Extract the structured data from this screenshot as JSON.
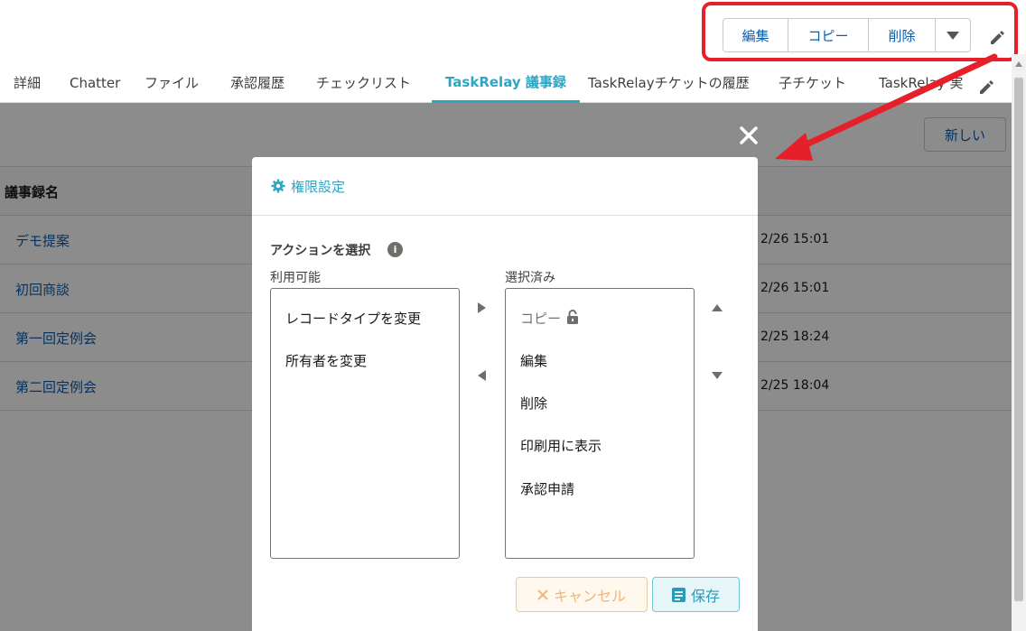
{
  "record_actions": {
    "edit_label": "編集",
    "copy_label": "コピー",
    "delete_label": "削除"
  },
  "tabs": [
    {
      "label": "詳細"
    },
    {
      "label": "Chatter"
    },
    {
      "label": "ファイル"
    },
    {
      "label": "承認履歴"
    },
    {
      "label": "チェックリスト"
    },
    {
      "label": "TaskRelay 議事録"
    },
    {
      "label": "TaskRelayチケットの履歴"
    },
    {
      "label": "子チケット"
    },
    {
      "label": "TaskRelay 実"
    }
  ],
  "list": {
    "new_label": "新しい",
    "column_header": "議事録名",
    "rows": [
      {
        "name": "デモ提案",
        "date": "2/26 15:01"
      },
      {
        "name": "初回商談",
        "date": "2/26 15:01"
      },
      {
        "name": "第一回定例会",
        "date": "2/25 18:24"
      },
      {
        "name": "第二回定例会",
        "date": "2/25 18:04"
      }
    ]
  },
  "modal": {
    "title": "権限設定",
    "section_label": "アクションを選択",
    "info_icon_text": "i",
    "available_label": "利用可能",
    "selected_label": "選択済み",
    "available_items": [
      "レコードタイプを変更",
      "所有者を変更"
    ],
    "selected_items": [
      "コピー",
      "編集",
      "削除",
      "印刷用に表示",
      "承認申請"
    ],
    "cancel_label": "キャンセル",
    "save_label": "保存"
  },
  "colors": {
    "accent": "#2fa5c3",
    "link": "#0b5cab",
    "highlight": "#e5202a"
  }
}
